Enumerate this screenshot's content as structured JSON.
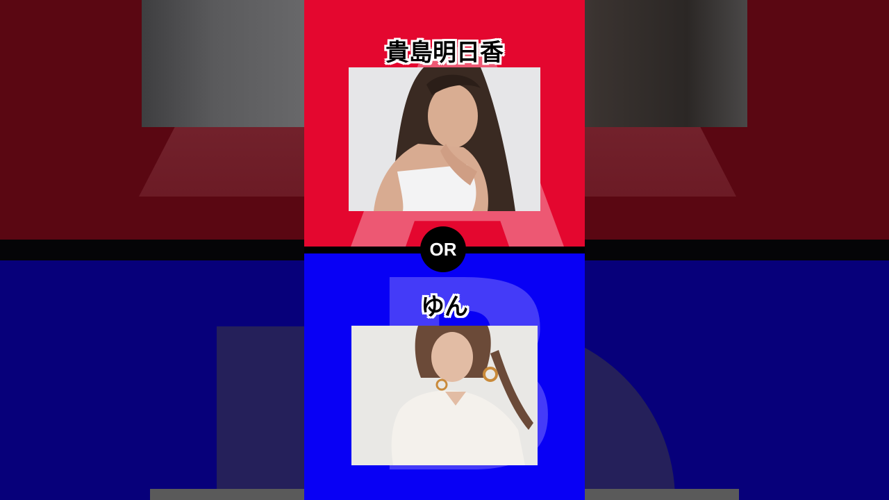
{
  "option_a": {
    "name": "貴島明日香",
    "watermark_letter": "A",
    "panel_color": "#e4072f"
  },
  "option_b": {
    "name": "ゆん",
    "watermark_letter": "B",
    "panel_color": "#0800f5"
  },
  "versus": {
    "label": "OR"
  }
}
